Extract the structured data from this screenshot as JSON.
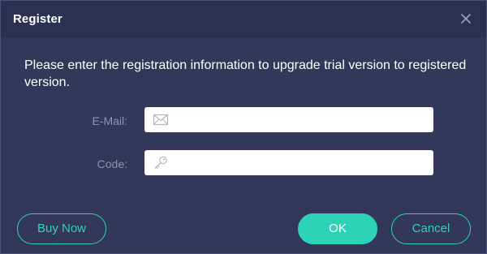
{
  "dialog": {
    "title": "Register",
    "close_icon": "close-icon"
  },
  "instructions": "Please enter the registration information to upgrade trial version to registered version.",
  "form": {
    "email": {
      "label": "E-Mail:",
      "value": "",
      "placeholder": "",
      "icon": "envelope-icon"
    },
    "code": {
      "label": "Code:",
      "value": "",
      "placeholder": "",
      "icon": "key-icon"
    }
  },
  "buttons": {
    "buy_now": "Buy Now",
    "ok": "OK",
    "cancel": "Cancel"
  },
  "colors": {
    "background": "#333759",
    "titlebar": "#2c3051",
    "accent": "#2dd3b7",
    "label_text": "#8f93b3",
    "text": "#ffffff"
  }
}
